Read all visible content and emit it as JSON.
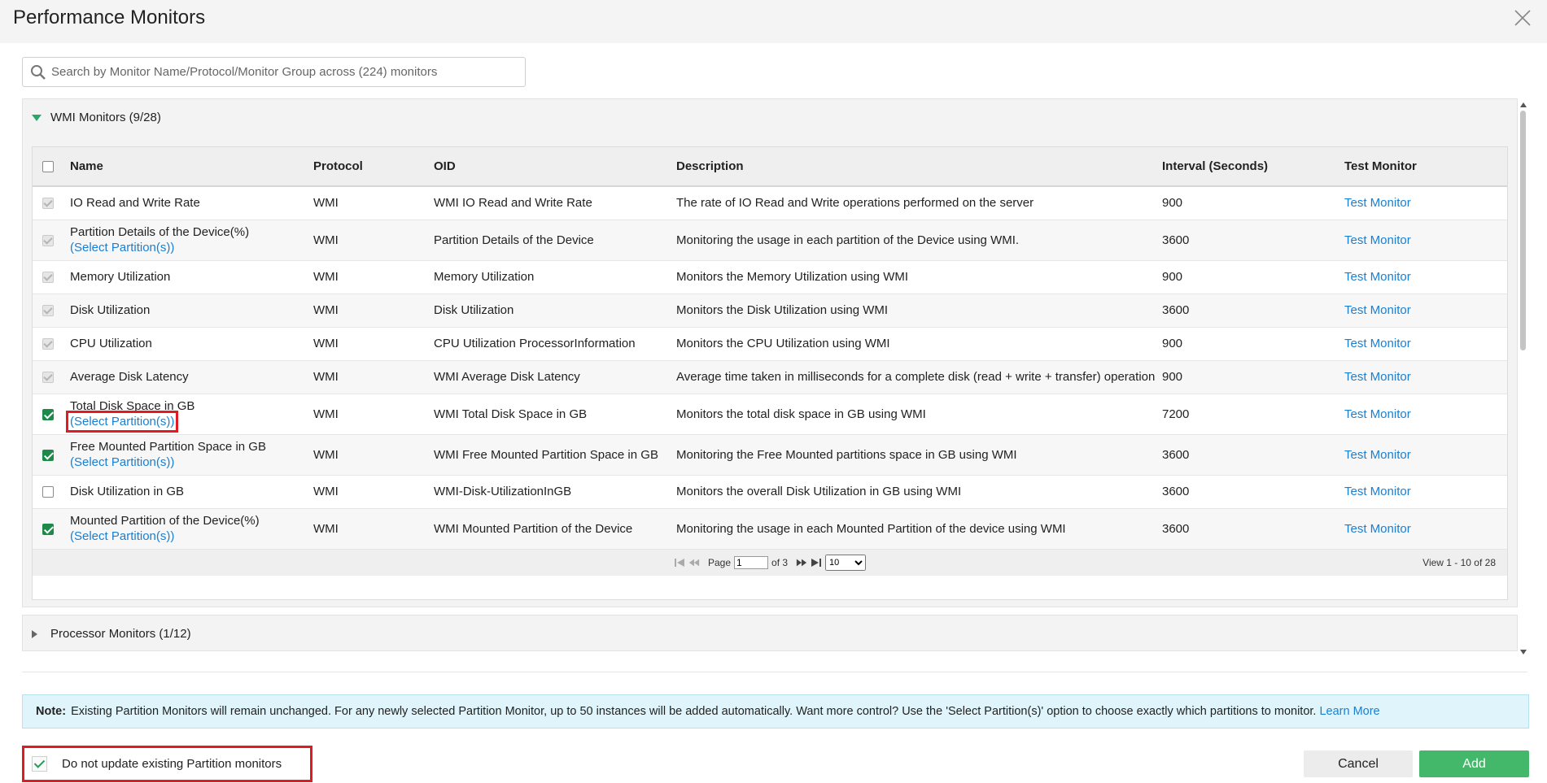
{
  "dialog": {
    "title": "Performance Monitors"
  },
  "search": {
    "placeholder": "Search by Monitor Name/Protocol/Monitor Group across (224) monitors"
  },
  "groups": {
    "wmi": {
      "label": "WMI Monitors (9/28)",
      "expanded": true
    },
    "processor": {
      "label": "Processor Monitors (1/12)",
      "expanded": false
    }
  },
  "table": {
    "columns": {
      "name": "Name",
      "protocol": "Protocol",
      "oid": "OID",
      "description": "Description",
      "interval": "Interval (Seconds)",
      "test": "Test Monitor"
    },
    "rows": [
      {
        "name": "IO Read and Write Rate",
        "sub": "",
        "protocol": "WMI",
        "oid": "WMI IO Read and Write Rate",
        "description": "The rate of IO Read and Write operations performed on the server",
        "interval": "900",
        "test": "Test Monitor",
        "check": "disabled"
      },
      {
        "name": "Partition Details of the Device(%)",
        "sub": "(Select Partition(s))",
        "protocol": "WMI",
        "oid": "Partition Details of the Device",
        "description": "Monitoring the usage in each partition of the Device using WMI.",
        "interval": "3600",
        "test": "Test Monitor",
        "check": "disabled"
      },
      {
        "name": "Memory Utilization",
        "sub": "",
        "protocol": "WMI",
        "oid": "Memory Utilization",
        "description": "Monitors the Memory Utilization using WMI",
        "interval": "900",
        "test": "Test Monitor",
        "check": "disabled"
      },
      {
        "name": "Disk Utilization",
        "sub": "",
        "protocol": "WMI",
        "oid": "Disk Utilization",
        "description": "Monitors the Disk Utilization using WMI",
        "interval": "3600",
        "test": "Test Monitor",
        "check": "disabled"
      },
      {
        "name": "CPU Utilization",
        "sub": "",
        "protocol": "WMI",
        "oid": "CPU Utilization ProcessorInformation",
        "description": "Monitors the CPU Utilization using WMI",
        "interval": "900",
        "test": "Test Monitor",
        "check": "disabled"
      },
      {
        "name": "Average Disk Latency",
        "sub": "",
        "protocol": "WMI",
        "oid": "WMI Average Disk Latency",
        "description": "Average time taken in milliseconds for a complete disk (read + write + transfer) operation",
        "interval": "900",
        "test": "Test Monitor",
        "check": "disabled"
      },
      {
        "name": "Total Disk Space in GB",
        "sub": "(Select Partition(s))",
        "protocol": "WMI",
        "oid": "WMI Total Disk Space in GB",
        "description": "Monitors the total disk space in GB using WMI",
        "interval": "7200",
        "test": "Test Monitor",
        "check": "checked"
      },
      {
        "name": "Free Mounted Partition Space in GB",
        "sub": "(Select Partition(s))",
        "protocol": "WMI",
        "oid": "WMI Free Mounted Partition Space in GB",
        "description": "Monitoring the Free Mounted partitions space in GB using WMI",
        "interval": "3600",
        "test": "Test Monitor",
        "check": "checked"
      },
      {
        "name": "Disk Utilization in GB",
        "sub": "",
        "protocol": "WMI",
        "oid": "WMI-Disk-UtilizationInGB",
        "description": "Monitors the overall Disk Utilization in GB using WMI",
        "interval": "3600",
        "test": "Test Monitor",
        "check": "unchecked"
      },
      {
        "name": "Mounted Partition of the Device(%)",
        "sub": "(Select Partition(s))",
        "protocol": "WMI",
        "oid": "WMI Mounted Partition of the Device",
        "description": "Monitoring the usage in each Mounted Partition of the device using WMI",
        "interval": "3600",
        "test": "Test Monitor",
        "check": "checked"
      }
    ]
  },
  "pager": {
    "page_label": "Page",
    "page_value": "1",
    "of_label": "of 3",
    "page_size": "10",
    "view_text": "View 1 - 10 of 28"
  },
  "note": {
    "label": "Note:",
    "text": "Existing Partition Monitors will remain unchanged. For any newly selected Partition Monitor, up to 50 instances will be added automatically. Want more control? Use the 'Select Partition(s)' option to choose exactly which partitions to monitor.",
    "link": "Learn More"
  },
  "footer": {
    "do_not_update_label": "Do not update existing Partition monitors",
    "do_not_update_checked": true,
    "cancel_label": "Cancel",
    "add_label": "Add"
  },
  "colors": {
    "link": "#1a7fd1",
    "add_button": "#43b86a",
    "highlight": "#e01b24",
    "note_bg": "#dff5fb"
  }
}
